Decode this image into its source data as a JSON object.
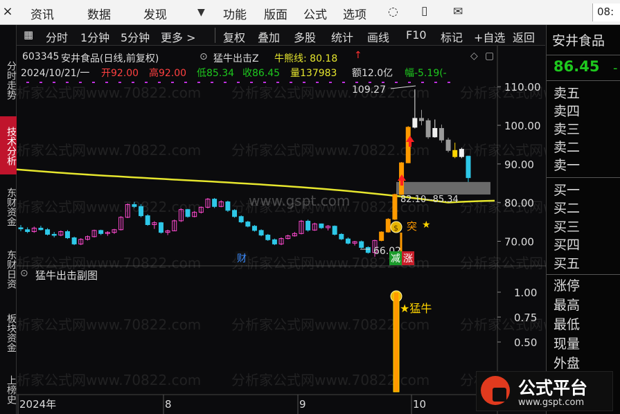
{
  "menubar": {
    "items": [
      "资讯",
      "数据",
      "发现",
      "功能",
      "版面",
      "公式",
      "选项"
    ],
    "clock": "08:"
  },
  "lefttabs": [
    "分时走势",
    "技术分析",
    "东财资金",
    "东财日资",
    "板块资金",
    "上榜史"
  ],
  "toolbar": {
    "items": [
      "分时",
      "1分钟",
      "5分钟",
      "更多 >",
      "复权",
      "叠加",
      "多股",
      "统计",
      "画线",
      "F10",
      "标记",
      "+自选",
      "返回"
    ]
  },
  "header": {
    "code": "603345",
    "name": "安井食品(日线,前复权)",
    "indicator": "猛牛出击Z",
    "bull_bear_label": "牛熊线: 80.18",
    "arrow": "↑"
  },
  "ohlc": {
    "date": "2024/10/21/一",
    "open": "开92.00",
    "high": "高92.00",
    "low": "低85.34",
    "close": "收86.45",
    "volume": "量137983",
    "amount": "额12.0亿",
    "change": "幅-5.19(-"
  },
  "rightpanel": {
    "stock_name": "安井食品",
    "price": "86.45",
    "sell_levels": [
      "卖五",
      "卖四",
      "卖三",
      "卖二",
      "卖一"
    ],
    "buy_levels": [
      "买一",
      "买二",
      "买三",
      "买四",
      "买五"
    ],
    "stats": [
      "涨停",
      "最高",
      "最低",
      "现量",
      "外盘"
    ]
  },
  "annotations": {
    "high_label": "109.27",
    "low_label": "66.02",
    "range_label": "82.10--85.34",
    "tu": "突",
    "star": "★",
    "jian": "减",
    "zhang": "涨",
    "sub_title": "猛牛出击副图",
    "sub_signal": "★猛牛"
  },
  "watermarks": {
    "site": "www.gspt.com",
    "repeat": "分析家公式网www.70822.com",
    "logo_title": "公式平台",
    "logo_url": "www.gspt.com"
  },
  "colors": {
    "up": "#ff4ad0",
    "down": "#2ec8e8",
    "bull_bear_line": "#e6e62e",
    "signal": "#ff9a00",
    "volume_green": "#1ec81e",
    "active_tab": "#c0142c"
  },
  "chart_data": {
    "type": "candlestick",
    "y_axis_main": [
      110.0,
      100.0,
      90.0,
      80.0,
      70.0
    ],
    "y_axis_sub": [
      1.0,
      0.75,
      0.5
    ],
    "ylim_main": [
      64,
      112
    ],
    "ylim_sub": [
      0,
      1.25
    ],
    "x_labels": [
      "2024年",
      "8",
      "9",
      "10"
    ],
    "bull_bear_line": {
      "name": "牛熊线",
      "last": 80.18
    },
    "candles_ohlc": [
      [
        73.5,
        74.2,
        72.6,
        73.2
      ],
      [
        73.0,
        73.6,
        72.1,
        72.5
      ],
      [
        72.5,
        73.8,
        72.2,
        73.4
      ],
      [
        73.4,
        74.0,
        72.8,
        73.0
      ],
      [
        73.0,
        73.4,
        71.5,
        71.8
      ],
      [
        71.8,
        72.4,
        71.0,
        71.6
      ],
      [
        71.6,
        72.8,
        71.3,
        72.5
      ],
      [
        72.5,
        72.9,
        70.6,
        70.9
      ],
      [
        70.9,
        71.2,
        69.0,
        69.3
      ],
      [
        69.3,
        70.8,
        69.0,
        70.5
      ],
      [
        70.5,
        71.5,
        70.2,
        71.2
      ],
      [
        71.2,
        73.0,
        71.0,
        72.8
      ],
      [
        72.8,
        73.0,
        71.6,
        72.0
      ],
      [
        72.0,
        72.6,
        71.4,
        72.3
      ],
      [
        72.3,
        73.2,
        71.9,
        73.0
      ],
      [
        73.0,
        76.5,
        72.8,
        76.2
      ],
      [
        76.2,
        79.8,
        76.0,
        79.5
      ],
      [
        79.5,
        80.2,
        78.6,
        79.0
      ],
      [
        79.0,
        79.6,
        76.2,
        76.6
      ],
      [
        76.6,
        77.0,
        74.0,
        74.3
      ],
      [
        74.3,
        75.2,
        73.2,
        74.8
      ],
      [
        74.8,
        75.0,
        72.0,
        72.3
      ],
      [
        72.3,
        73.0,
        71.6,
        72.7
      ],
      [
        72.7,
        75.6,
        72.6,
        75.3
      ],
      [
        75.3,
        78.5,
        75.0,
        78.2
      ],
      [
        78.2,
        78.4,
        76.1,
        76.4
      ],
      [
        76.4,
        77.8,
        76.2,
        77.5
      ],
      [
        77.5,
        79.0,
        77.2,
        78.8
      ],
      [
        78.8,
        81.2,
        78.5,
        80.9
      ],
      [
        80.9,
        81.2,
        78.6,
        79.0
      ],
      [
        79.0,
        80.6,
        78.8,
        80.2
      ],
      [
        80.2,
        80.5,
        77.6,
        78.0
      ],
      [
        78.0,
        78.3,
        76.1,
        76.4
      ],
      [
        76.4,
        76.7,
        74.7,
        75.0
      ],
      [
        75.0,
        75.3,
        73.6,
        73.9
      ],
      [
        73.9,
        74.2,
        72.5,
        72.8
      ],
      [
        72.8,
        73.1,
        71.3,
        71.6
      ],
      [
        71.6,
        71.9,
        70.1,
        70.4
      ],
      [
        70.4,
        70.7,
        69.0,
        69.3
      ],
      [
        69.3,
        71.0,
        69.0,
        70.7
      ],
      [
        70.7,
        71.7,
        70.5,
        71.4
      ],
      [
        71.4,
        72.4,
        71.2,
        72.0
      ],
      [
        72.0,
        75.5,
        71.8,
        75.2
      ],
      [
        75.2,
        75.6,
        72.5,
        72.9
      ],
      [
        72.9,
        74.8,
        72.7,
        74.5
      ],
      [
        74.5,
        74.6,
        73.2,
        73.5
      ],
      [
        73.5,
        74.2,
        72.8,
        73.9
      ],
      [
        73.9,
        74.1,
        71.5,
        71.8
      ],
      [
        71.8,
        72.1,
        70.3,
        70.6
      ],
      [
        70.6,
        71.0,
        69.2,
        69.5
      ],
      [
        69.5,
        70.1,
        68.9,
        69.9
      ],
      [
        69.9,
        70.2,
        68.1,
        68.4
      ],
      [
        68.4,
        68.7,
        66.8,
        67.1
      ],
      [
        67.1,
        70.4,
        66.0,
        70.2
      ],
      [
        70.2,
        72.6,
        70.0,
        72.4
      ],
      [
        72.4,
        76.0,
        72.2,
        75.7
      ],
      [
        75.7,
        82.3,
        75.5,
        82.1
      ],
      [
        82.1,
        90.5,
        82.0,
        90.3
      ],
      [
        90.3,
        99.8,
        90.2,
        99.5
      ],
      [
        99.5,
        109.3,
        99.2,
        101.8
      ],
      [
        101.8,
        104.0,
        100.0,
        101.2
      ],
      [
        101.2,
        101.8,
        96.5,
        97.0
      ],
      [
        97.0,
        101.5,
        96.8,
        99.2
      ],
      [
        99.2,
        100.2,
        95.5,
        96.2
      ],
      [
        96.2,
        96.8,
        93.0,
        93.5
      ],
      [
        93.5,
        95.5,
        91.5,
        91.9
      ],
      [
        91.9,
        94.2,
        91.5,
        93.8
      ],
      [
        92.0,
        92.0,
        85.34,
        86.45
      ]
    ],
    "sub_signal_value": 1.0
  }
}
